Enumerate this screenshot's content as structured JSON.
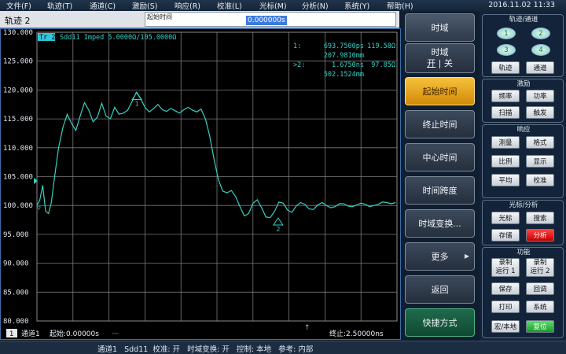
{
  "menubar": {
    "items": [
      "文件(F)",
      "轨迹(T)",
      "通道(C)",
      "激励(S)",
      "响应(R)",
      "校准(L)",
      "光标(M)",
      "分析(N)",
      "系统(Y)",
      "帮助(H)"
    ],
    "datetime": "2016.11.02 11:33"
  },
  "topbar": {
    "trace_title": "轨迹 2",
    "entry_label": "起始时间",
    "entry_value": "0.000000s"
  },
  "chart": {
    "trace_label": "Tr 2",
    "trace_desc": "Sdd11 Imped 5.0000Ω/105.0000Ω",
    "marker_readout": [
      {
        "id": "1:",
        "x": "693.7500ps",
        "y": "119.58Ω"
      },
      {
        "id": "",
        "x": "207.9810mm",
        "y": ""
      },
      {
        "id": ">2:",
        "x": "1.6750ns",
        "y": "97.85Ω"
      },
      {
        "id": "",
        "x": "502.1524mm",
        "y": ""
      }
    ],
    "footer_channel": "通道1",
    "footer_start": "起始:0.00000s",
    "footer_stop": "终止:2.50000ns",
    "footer_num": "1",
    "trace_color": "#38d0c4"
  },
  "chart_data": {
    "type": "line",
    "title": "",
    "xlabel": "",
    "ylabel": "",
    "xlim": [
      0,
      2.5
    ],
    "x_unit": "ns",
    "ylim": [
      80,
      130
    ],
    "ytick_labels": [
      "130.000",
      "125.000",
      "120.000",
      "115.000",
      "110.000",
      "105.000",
      "100.000",
      "95.000",
      "90.000",
      "85.000",
      "80.000"
    ],
    "reference_level": 100,
    "grid": true,
    "series": [
      {
        "name": "",
        "x": [
          0.0,
          0.02,
          0.04,
          0.06,
          0.08,
          0.1,
          0.12,
          0.15,
          0.18,
          0.21,
          0.24,
          0.27,
          0.3,
          0.33,
          0.36,
          0.39,
          0.42,
          0.45,
          0.48,
          0.51,
          0.54,
          0.57,
          0.6,
          0.63,
          0.66,
          0.69,
          0.72,
          0.75,
          0.78,
          0.81,
          0.84,
          0.87,
          0.9,
          0.93,
          0.96,
          0.99,
          1.02,
          1.05,
          1.08,
          1.11,
          1.14,
          1.17,
          1.2,
          1.23,
          1.26,
          1.29,
          1.32,
          1.35,
          1.38,
          1.41,
          1.44,
          1.47,
          1.5,
          1.53,
          1.56,
          1.59,
          1.62,
          1.65,
          1.68,
          1.71,
          1.74,
          1.77,
          1.8,
          1.83,
          1.86,
          1.89,
          1.92,
          1.95,
          1.98,
          2.01,
          2.04,
          2.07,
          2.1,
          2.13,
          2.16,
          2.19,
          2.22,
          2.25,
          2.28,
          2.31,
          2.34,
          2.37,
          2.4,
          2.43,
          2.46,
          2.49
        ],
        "values": [
          100.0,
          101.0,
          103.5,
          99.0,
          98.6,
          100.5,
          104.5,
          110.0,
          113.5,
          115.8,
          114.2,
          113.0,
          115.5,
          117.8,
          116.5,
          114.5,
          115.3,
          117.7,
          115.5,
          115.0,
          117.0,
          115.8,
          116.0,
          116.5,
          118.0,
          119.6,
          118.5,
          117.0,
          116.2,
          116.8,
          117.5,
          116.6,
          116.3,
          116.8,
          116.4,
          116.0,
          116.6,
          117.0,
          116.5,
          116.2,
          116.7,
          115.0,
          112.0,
          108.0,
          104.5,
          102.5,
          102.2,
          102.6,
          101.5,
          99.8,
          98.2,
          98.6,
          100.4,
          101.0,
          99.6,
          98.0,
          97.9,
          99.0,
          100.6,
          100.4,
          99.2,
          98.8,
          99.9,
          100.5,
          100.2,
          99.4,
          99.3,
          100.1,
          100.5,
          100.0,
          99.6,
          99.8,
          100.3,
          100.3,
          99.9,
          99.8,
          100.1,
          100.4,
          100.2,
          99.8,
          100.0,
          100.2,
          100.6,
          100.5,
          100.3,
          100.5
        ]
      }
    ],
    "markers": [
      {
        "label": "1",
        "x": 0.69375,
        "y": 119.58
      },
      {
        "label": "2",
        "x": 1.675,
        "y": 97.85
      }
    ]
  },
  "softkeys": {
    "header": "时域",
    "toggle_title": "时域",
    "toggle_on": "开",
    "toggle_off": "关",
    "items": [
      "起始时间",
      "终止时间",
      "中心时间",
      "时间跨度",
      "时域变换...",
      "更多",
      "返回",
      "快捷方式"
    ]
  },
  "hardkeys": {
    "group1_title": "轨迹/通道",
    "ch_buttons": [
      "1",
      "2",
      "3",
      "4"
    ],
    "trace_btn": "轨迹",
    "channel_btn": "通道",
    "group2_title": "激励",
    "freq_btn": "频率",
    "power_btn": "功率",
    "sweep_btn": "扫描",
    "trigger_btn": "触发",
    "group3_title": "响应",
    "meas_btn": "测量",
    "format_btn": "格式",
    "scale_btn": "比例",
    "display_btn": "显示",
    "avg_btn": "平均",
    "cal_btn": "校准",
    "group4_title": "光标/分析",
    "marker_btn": "光标",
    "search_btn": "搜索",
    "store_btn": "存储",
    "analysis_btn": "分析",
    "group5_title": "功能",
    "macro1_btn": [
      "录制",
      "运行 1"
    ],
    "macro2_btn": [
      "录制",
      "运行 2"
    ],
    "save_btn": "保存",
    "recall_btn": "回调",
    "print_btn": "打印",
    "system_btn": "系统",
    "macro_local_btn": "宏/本地",
    "preset_btn": "复位"
  },
  "status": {
    "text": "通道1   Sdd11  校准: 开   时域变换: 开   控制: 本地   参考: 内部"
  }
}
